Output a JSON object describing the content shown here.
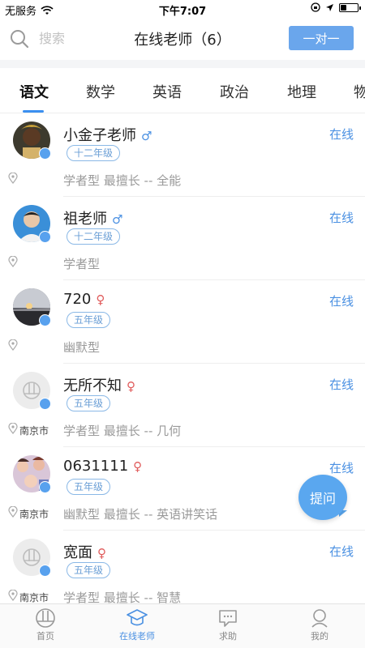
{
  "statusbar": {
    "carrier": "无服务",
    "time": "下午7:07",
    "battery_level": 0.35
  },
  "header": {
    "search_placeholder": "搜索",
    "title": "在线老师（6）",
    "one_on_one_label": "一对一"
  },
  "tabs": [
    {
      "label": "语文",
      "active": true
    },
    {
      "label": "数学"
    },
    {
      "label": "英语"
    },
    {
      "label": "政治"
    },
    {
      "label": "地理"
    },
    {
      "label": "物"
    }
  ],
  "teachers": [
    {
      "name": "小金子老师",
      "gender": "♂",
      "grade": "十二年级",
      "status": "在线",
      "city": "",
      "desc": "学者型  最擅长 -- 全能"
    },
    {
      "name": "祖老师",
      "gender": "♂",
      "grade": "十二年级",
      "status": "在线",
      "city": "",
      "desc": "学者型"
    },
    {
      "name": "720",
      "gender": "♀",
      "grade": "五年级",
      "status": "在线",
      "city": "",
      "desc": "幽默型"
    },
    {
      "name": "无所不知",
      "gender": "♀",
      "grade": "五年级",
      "status": "在线",
      "city": "南京市",
      "desc": "学者型  最擅长 -- 几何"
    },
    {
      "name": "0631111",
      "gender": "♀",
      "grade": "五年级",
      "status": "在线",
      "city": "南京市",
      "desc": "幽默型  最擅长 -- 英语讲笑话"
    },
    {
      "name": "宽面",
      "gender": "♀",
      "grade": "五年级",
      "status": "在线",
      "city": "南京市",
      "desc": "学者型  最擅长 -- 智慧"
    }
  ],
  "ask_button": "提问",
  "nav": [
    {
      "label": "首页",
      "icon": "home-icon"
    },
    {
      "label": "在线老师",
      "icon": "teacher-cap-icon",
      "active": true
    },
    {
      "label": "求助",
      "icon": "help-chat-icon"
    },
    {
      "label": "我的",
      "icon": "profile-icon"
    }
  ],
  "colors": {
    "accent": "#4a90e2",
    "button": "#6aa6ec",
    "female": "#e05b5b"
  }
}
